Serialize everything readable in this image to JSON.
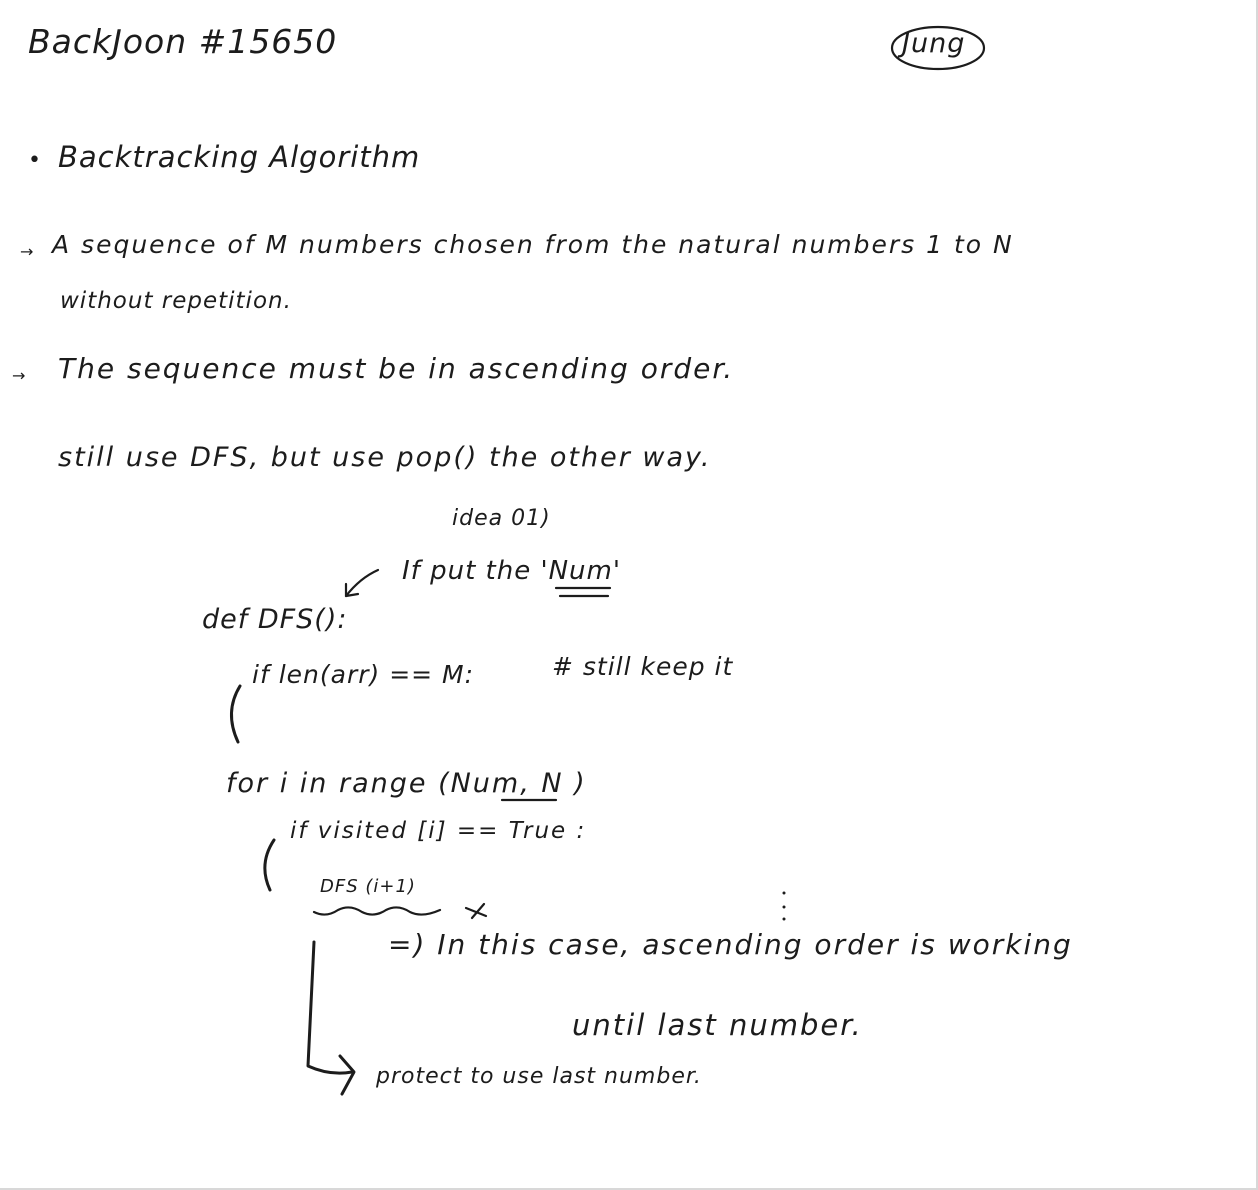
{
  "header": {
    "title": "BackJoon #15650",
    "author_signature": "Jung"
  },
  "notes": {
    "topic": "Backtracking Algorithm",
    "line1": "A sequence of M numbers chosen from the natural numbers 1 to N",
    "line1b": "without repetition.",
    "line2": "The sequence must be in ascending order.",
    "line3": "still use DFS, but use pop() the other way.",
    "idea_label": "idea 01)",
    "idea_note": "If put the 'Num'",
    "code_def": "def DFS():",
    "code_if": "if len(arr) == M:",
    "code_comment": "# still keep it",
    "code_for": "for i in range (Num, N )",
    "code_if_visited": "if visited [i] == True :",
    "code_dfs_call": "DFS (i+1)",
    "conclusion1": "=) In this case, ascending order is working",
    "conclusion2": "until last number.",
    "conclusion3": "protect to use last number."
  }
}
